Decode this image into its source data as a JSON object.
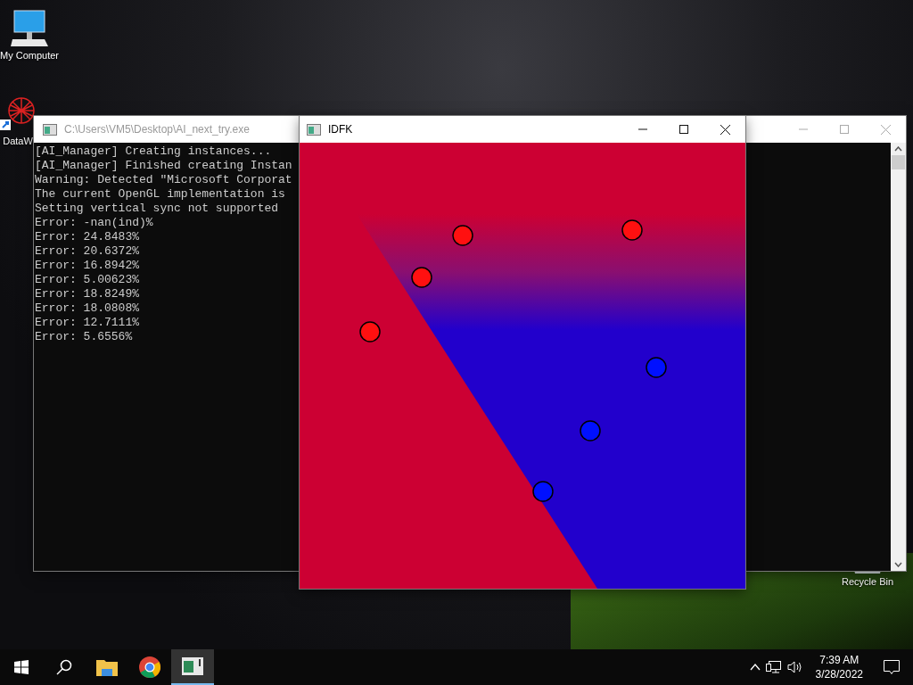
{
  "desktop_icons": [
    {
      "kind": "computer",
      "label": "My Computer"
    },
    {
      "kind": "shortcut",
      "label": "DataW"
    },
    {
      "kind": "bin",
      "label": "Recycle Bin"
    }
  ],
  "console_window": {
    "title": "C:\\Users\\VM5\\Desktop\\AI_next_try.exe",
    "lines": [
      "[AI_Manager] Creating instances...",
      "[AI_Manager] Finished creating Instan",
      "Warning: Detected \"Microsoft Corporat",
      "The current OpenGL implementation is",
      "Setting vertical sync not supported",
      "Error: -nan(ind)%",
      "Error: 24.8483%",
      "Error: 20.6372%",
      "Error: 16.8942%",
      "Error: 5.00623%",
      "Error: 18.8249%",
      "Error: 18.0808%",
      "Error: 12.7111%",
      "Error: 5.6556%"
    ]
  },
  "plot_window": {
    "title": "IDFK"
  },
  "taskbar": {
    "apps": [
      {
        "kind": "explorer",
        "selected": false
      },
      {
        "kind": "browser",
        "selected": false
      },
      {
        "kind": "console",
        "selected": true
      }
    ],
    "clock": {
      "time": "7:39 AM",
      "date": "3/28/2022"
    }
  }
}
